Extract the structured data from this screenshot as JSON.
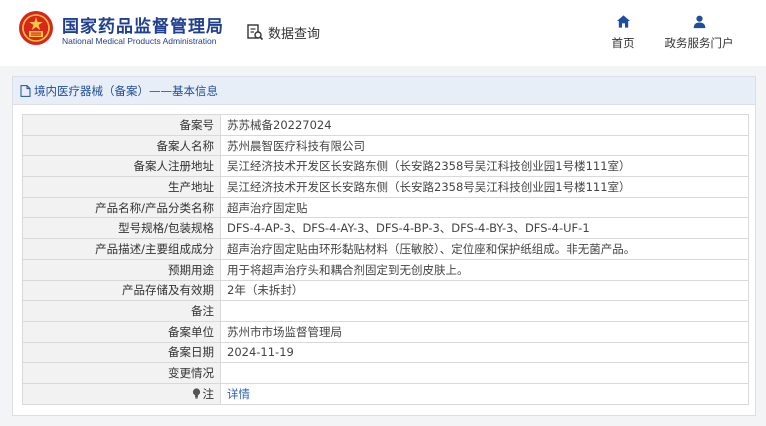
{
  "header": {
    "org_name_cn": "国家药品监督管理局",
    "org_name_en": "National Medical Products Administration",
    "query_label": "数据查询",
    "nav": [
      {
        "label": "首页",
        "icon": "home-icon"
      },
      {
        "label": "政务服务门户",
        "icon": "user-icon"
      }
    ]
  },
  "panel": {
    "title": "境内医疗器械（备案）——基本信息",
    "rows": [
      {
        "label": "备案号",
        "value": "苏苏械备20227024"
      },
      {
        "label": "备案人名称",
        "value": "苏州晨智医疗科技有限公司"
      },
      {
        "label": "备案人注册地址",
        "value": "吴江经济技术开发区长安路东侧（长安路2358号吴江科技创业园1号楼111室）"
      },
      {
        "label": "生产地址",
        "value": "吴江经济技术开发区长安路东侧（长安路2358号吴江科技创业园1号楼111室）"
      },
      {
        "label": "产品名称/产品分类名称",
        "value": "超声治疗固定贴"
      },
      {
        "label": "型号规格/包装规格",
        "value": "DFS-4-AP-3、DFS-4-AY-3、DFS-4-BP-3、DFS-4-BY-3、DFS-4-UF-1"
      },
      {
        "label": "产品描述/主要组成成分",
        "value": "超声治疗固定贴由环形黏贴材料（压敏胶）、定位座和保护纸组成。非无菌产品。"
      },
      {
        "label": "预期用途",
        "value": "用于将超声治疗头和耦合剂固定到无创皮肤上。"
      },
      {
        "label": "产品存储及有效期",
        "value": "2年（未拆封）"
      },
      {
        "label": "备注",
        "value": ""
      },
      {
        "label": "备案单位",
        "value": "苏州市市场监督管理局"
      },
      {
        "label": "备案日期",
        "value": "2024-11-19"
      },
      {
        "label": "变更情况",
        "value": ""
      }
    ],
    "note_row": {
      "label": "注",
      "link": "详情",
      "icon": "lightbulb-icon"
    }
  },
  "colors": {
    "brand_blue": "#1f3f8f",
    "link_blue": "#2a62b8",
    "label_bg": "#f2f2f2",
    "title_bg": "#e8eef7"
  }
}
